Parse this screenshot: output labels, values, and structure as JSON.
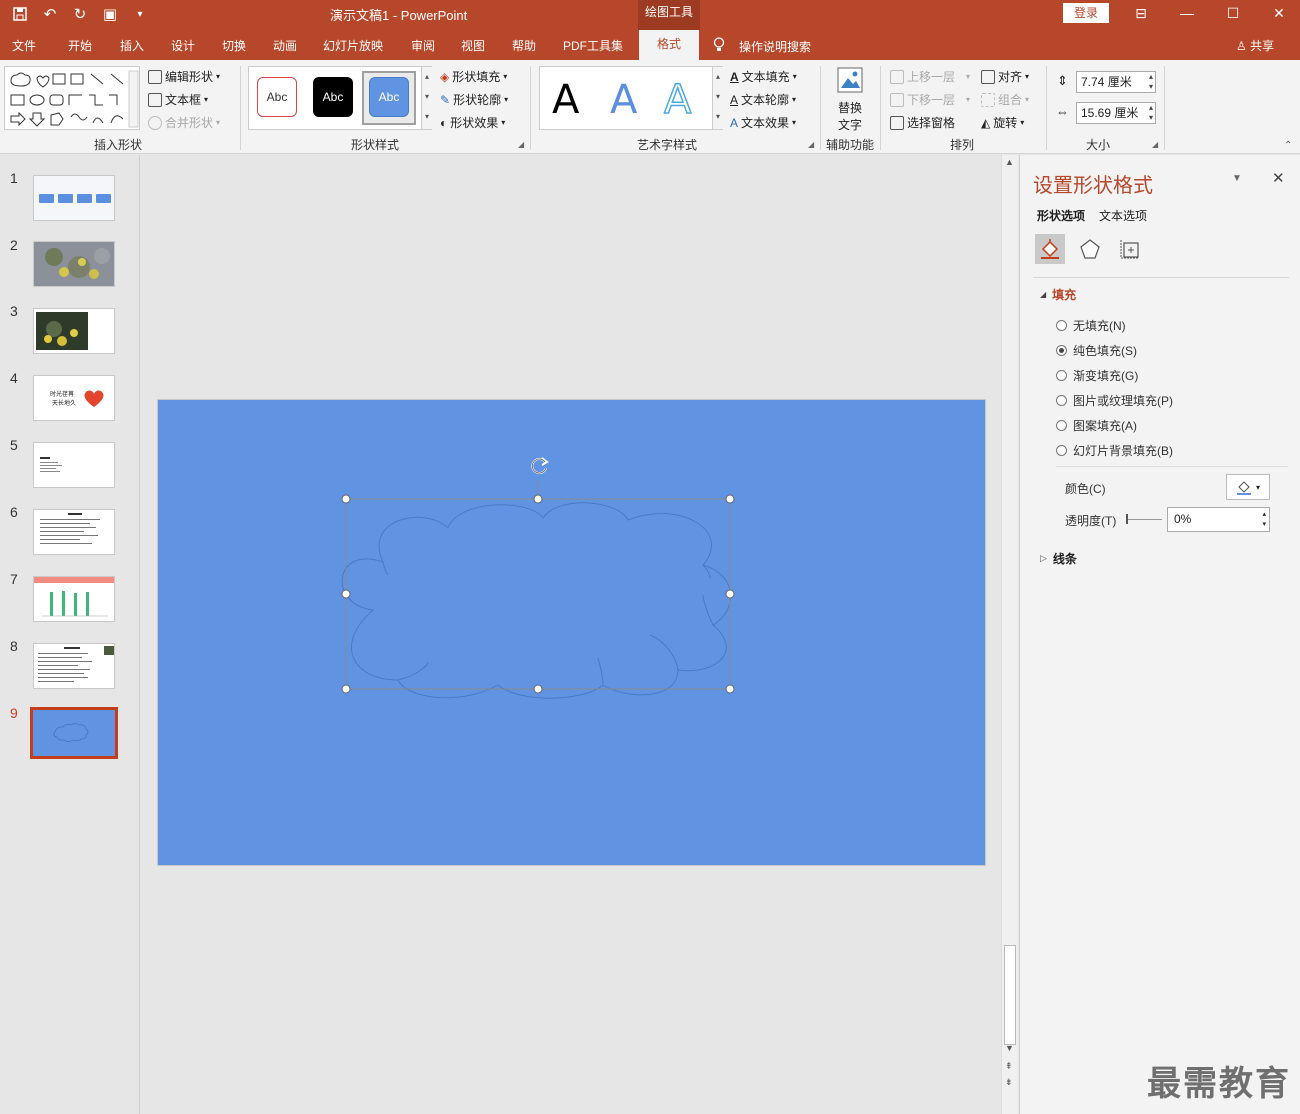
{
  "window": {
    "doc_title": "演示文稿1  -  PowerPoint",
    "tools_tab": "绘图工具",
    "login": "登录"
  },
  "menu": {
    "items": [
      "文件",
      "开始",
      "插入",
      "设计",
      "切换",
      "动画",
      "幻灯片放映",
      "审阅",
      "视图",
      "帮助",
      "PDF工具集",
      "格式"
    ],
    "search_tip": "操作说明搜索",
    "share": "共享"
  },
  "ribbon": {
    "insert_shapes": {
      "label": "插入形状",
      "edit_shape": "编辑形状",
      "text_box": "文本框",
      "merge_shapes": "合并形状"
    },
    "shape_styles": {
      "label": "形状样式",
      "swatch_text": "Abc",
      "fill": "形状填充",
      "outline": "形状轮廓",
      "effects": "形状效果"
    },
    "wordart": {
      "label": "艺术字样式",
      "letter": "A",
      "text_fill": "文本填充",
      "text_outline": "文本轮廓",
      "text_effects": "文本效果"
    },
    "accessibility": {
      "label": "辅助功能",
      "alt_text_line1": "替换",
      "alt_text_line2": "文字"
    },
    "arrange": {
      "label": "排列",
      "bring_forward": "上移一层",
      "send_backward": "下移一层",
      "selection_pane": "选择窗格",
      "align": "对齐",
      "group": "组合",
      "rotate": "旋转"
    },
    "size": {
      "label": "大小",
      "height": "7.74 厘米",
      "width": "15.69 厘米"
    }
  },
  "slides": {
    "numbers": [
      "1",
      "2",
      "3",
      "4",
      "5",
      "6",
      "7",
      "8",
      "9"
    ],
    "slide4_line1": "时光荏苒",
    "slide4_line2": "天长地久",
    "selected": 9
  },
  "format_pane": {
    "title": "设置形状格式",
    "tab_shape": "形状选项",
    "tab_text": "文本选项",
    "fill_section": "填充",
    "fill_options": [
      "无填充(N)",
      "纯色填充(S)",
      "渐变填充(G)",
      "图片或纹理填充(P)",
      "图案填充(A)",
      "幻灯片背景填充(B)"
    ],
    "selected_fill": 1,
    "color_label": "颜色(C)",
    "transparency_label": "透明度(T)",
    "transparency_value": "0%",
    "line_section": "线条"
  },
  "watermark": "最需教育",
  "colors": {
    "accent": "#b7472a",
    "slide_bg": "#6094e3"
  }
}
